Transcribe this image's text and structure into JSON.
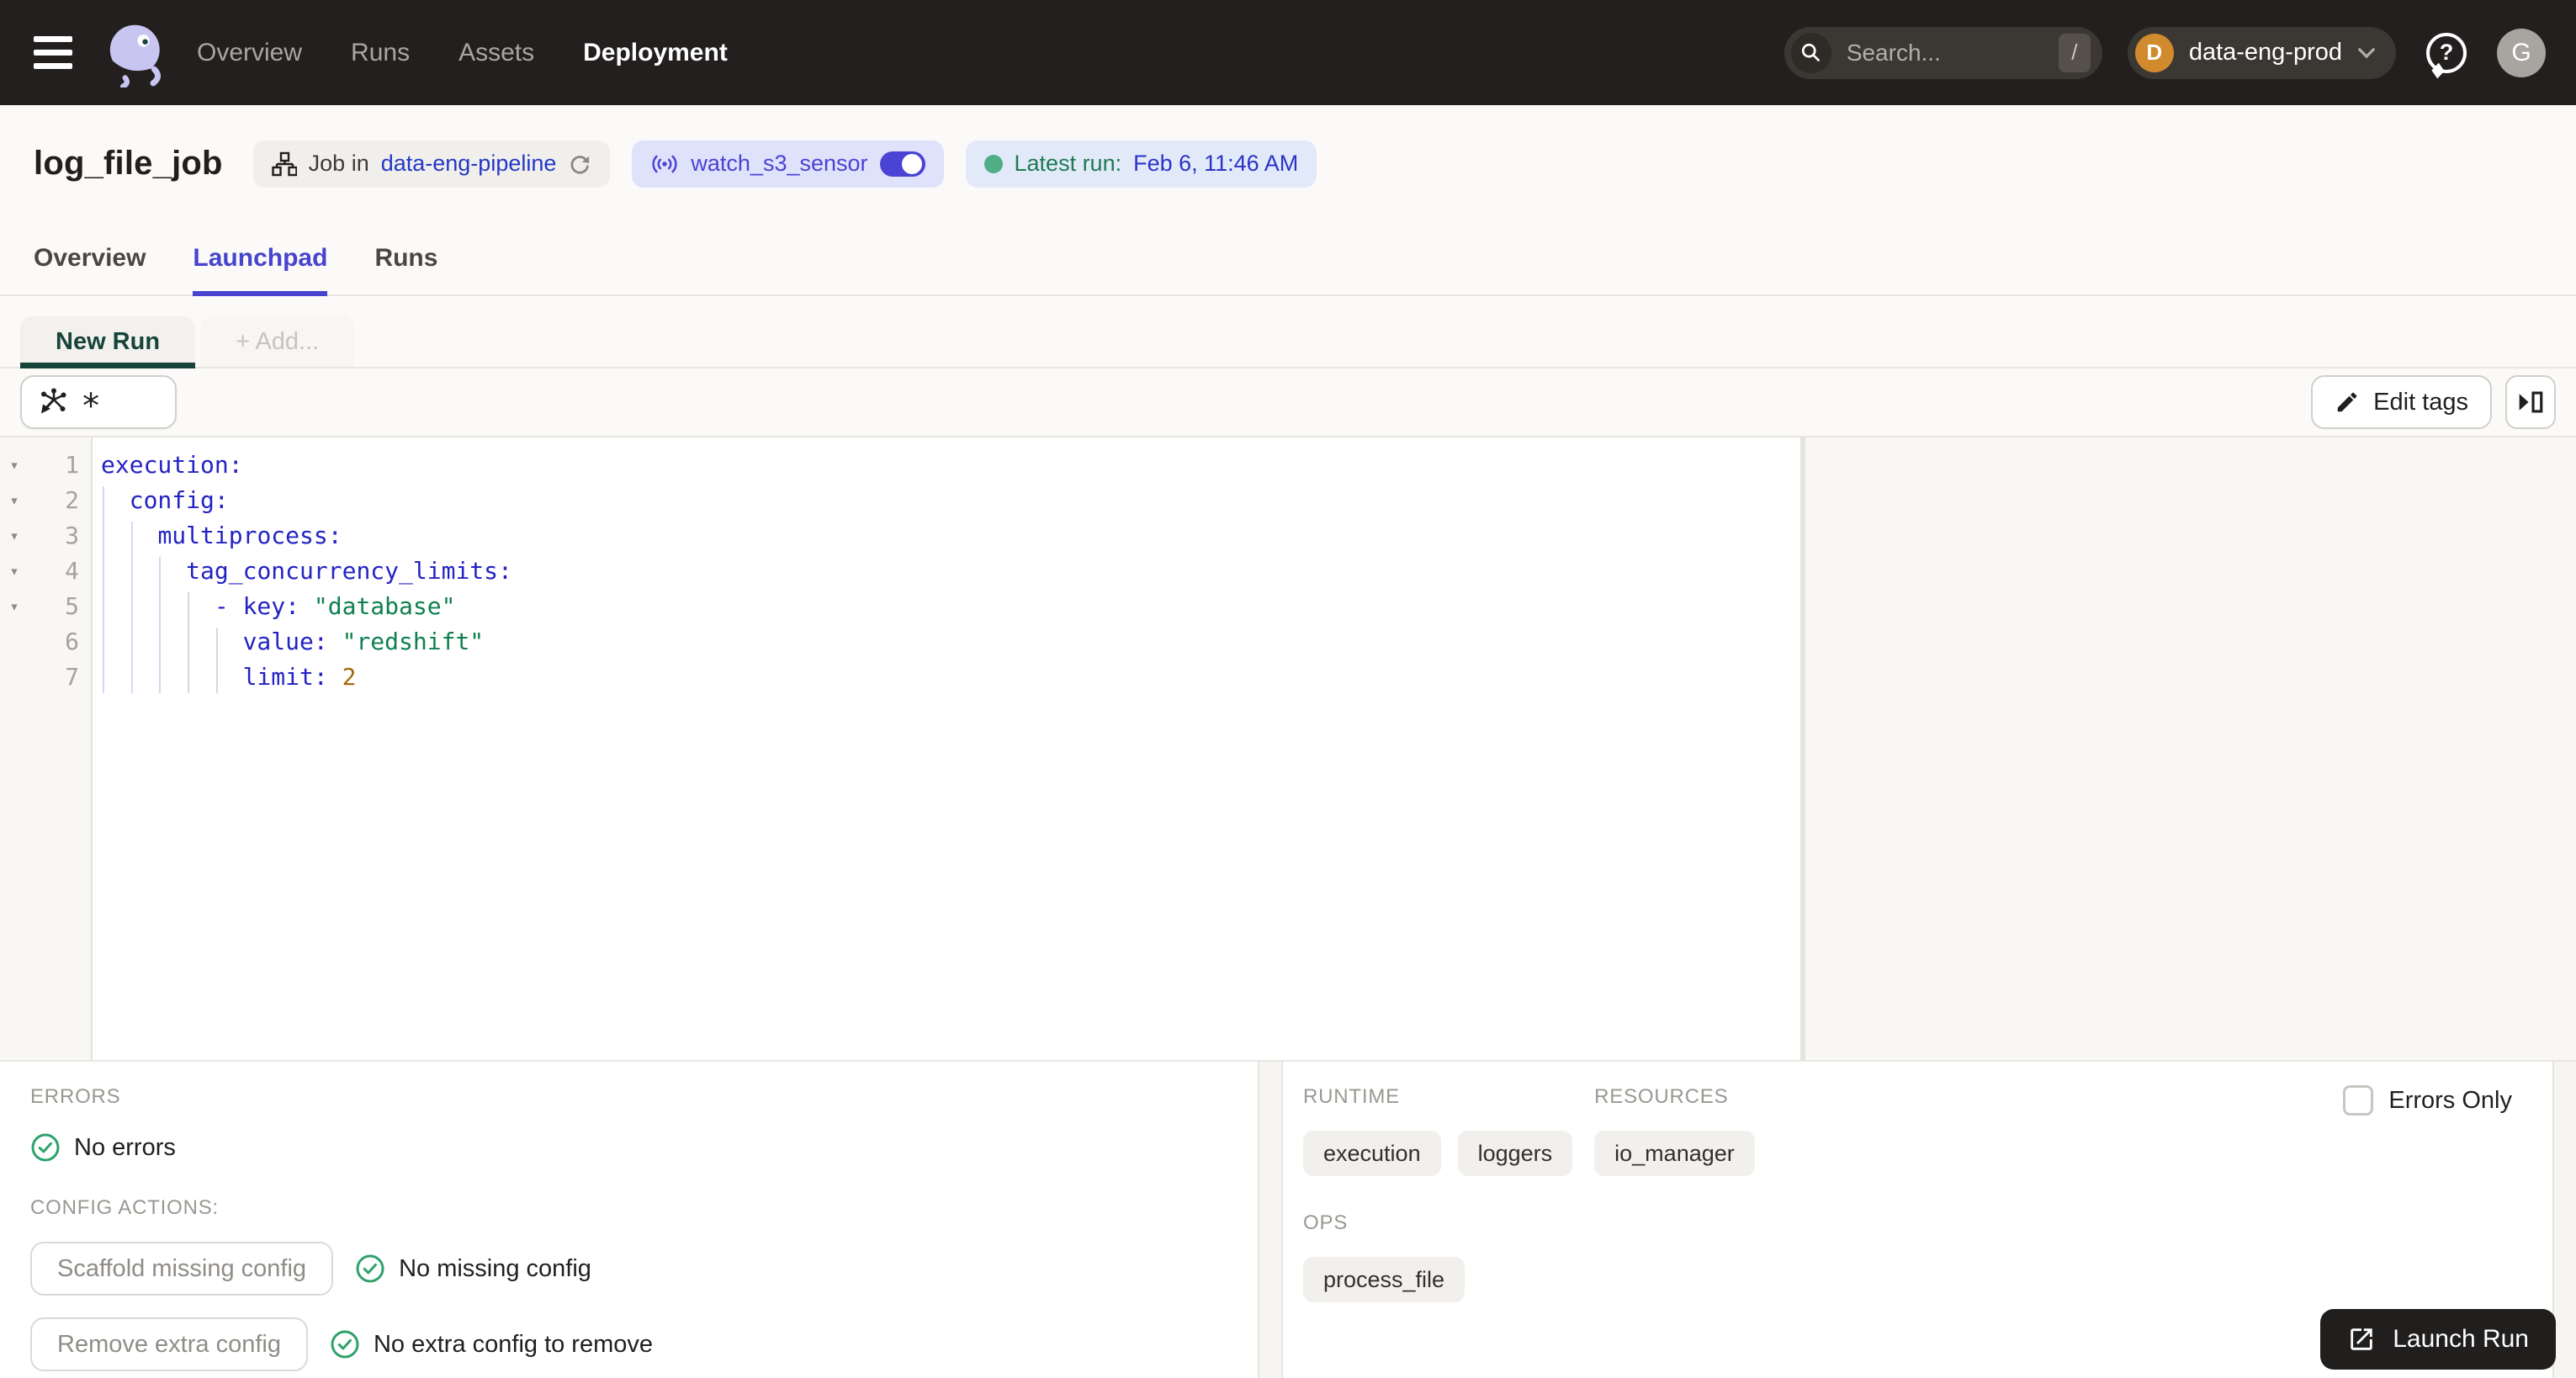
{
  "colors": {
    "nav_bg": "#221F1E",
    "accent_indigo": "#4744CE",
    "link_blue": "#2438C8",
    "sensor_indigo": "#4A43D4",
    "status_green": "#2EA26B",
    "latest_run_green": "#1D7B51",
    "run_tab_green": "#16443A",
    "deployment_orange": "#D18A2D",
    "code_key": "#2323C4",
    "code_string": "#0E8050",
    "code_number": "#A5690F",
    "launch_button_bg": "#211E1E"
  },
  "nav": {
    "items": [
      {
        "label": "Overview",
        "active": false
      },
      {
        "label": "Runs",
        "active": false
      },
      {
        "label": "Assets",
        "active": false
      },
      {
        "label": "Deployment",
        "active": true
      }
    ],
    "search": {
      "placeholder": "Search...",
      "shortcut": "/"
    },
    "deployment_switcher": {
      "initial": "D",
      "label": "data-eng-prod"
    },
    "help_glyph": "?",
    "avatar_initial": "G"
  },
  "page_header": {
    "title": "log_file_job",
    "job_pill": {
      "prefix": "Job in",
      "link": "data-eng-pipeline"
    },
    "sensor_pill": {
      "label": "watch_s3_sensor",
      "enabled": true
    },
    "latest_run_pill": {
      "label": "Latest run:",
      "value": "Feb 6, 11:46 AM"
    }
  },
  "tabs": [
    {
      "label": "Overview",
      "active": false
    },
    {
      "label": "Launchpad",
      "active": true
    },
    {
      "label": "Runs",
      "active": false
    }
  ],
  "run_tabs": {
    "tabs": [
      {
        "label": "New Run",
        "active": true
      }
    ],
    "add_label": "+ Add..."
  },
  "toolbar": {
    "op_selector_value": "*",
    "edit_tags_label": "Edit tags"
  },
  "editor": {
    "lines": [
      {
        "n": 1,
        "fold": true,
        "tokens": [
          [
            "k",
            "execution:"
          ]
        ]
      },
      {
        "n": 2,
        "fold": true,
        "tokens": [
          [
            "p",
            "  "
          ],
          [
            "k",
            "config:"
          ]
        ]
      },
      {
        "n": 3,
        "fold": true,
        "tokens": [
          [
            "p",
            "    "
          ],
          [
            "k",
            "multiprocess:"
          ]
        ]
      },
      {
        "n": 4,
        "fold": true,
        "tokens": [
          [
            "p",
            "      "
          ],
          [
            "k",
            "tag_concurrency_limits:"
          ]
        ]
      },
      {
        "n": 5,
        "fold": true,
        "tokens": [
          [
            "p",
            "        "
          ],
          [
            "k",
            "- key:"
          ],
          [
            "p",
            " "
          ],
          [
            "s",
            "\"database\""
          ]
        ]
      },
      {
        "n": 6,
        "fold": false,
        "tokens": [
          [
            "p",
            "          "
          ],
          [
            "k",
            "value:"
          ],
          [
            "p",
            " "
          ],
          [
            "s",
            "\"redshift\""
          ]
        ]
      },
      {
        "n": 7,
        "fold": false,
        "tokens": [
          [
            "p",
            "          "
          ],
          [
            "k",
            "limit:"
          ],
          [
            "p",
            " "
          ],
          [
            "n",
            "2"
          ]
        ]
      }
    ],
    "guides": [
      {
        "col": 0,
        "from": 2,
        "tone": "indigo"
      },
      {
        "col": 2,
        "from": 3,
        "tone": "indigo"
      },
      {
        "col": 4,
        "from": 4,
        "tone": "indigo"
      },
      {
        "col": 6,
        "from": 5,
        "tone": "gray"
      },
      {
        "col": 8,
        "from": 6,
        "tone": "gray"
      }
    ]
  },
  "errors_panel": {
    "heading": "ERRORS",
    "no_errors": "No errors",
    "actions_heading": "CONFIG ACTIONS:",
    "actions": [
      {
        "button": "Scaffold missing config",
        "status": "No missing config"
      },
      {
        "button": "Remove extra config",
        "status": "No extra config to remove"
      }
    ]
  },
  "preview_panel": {
    "errors_only_label": "Errors Only",
    "sections": [
      {
        "title": "RUNTIME",
        "tags": [
          "execution",
          "loggers"
        ]
      },
      {
        "title": "RESOURCES",
        "tags": [
          "io_manager"
        ]
      },
      {
        "title": "OPS",
        "tags": [
          "process_file"
        ]
      }
    ],
    "launch_label": "Launch Run"
  }
}
